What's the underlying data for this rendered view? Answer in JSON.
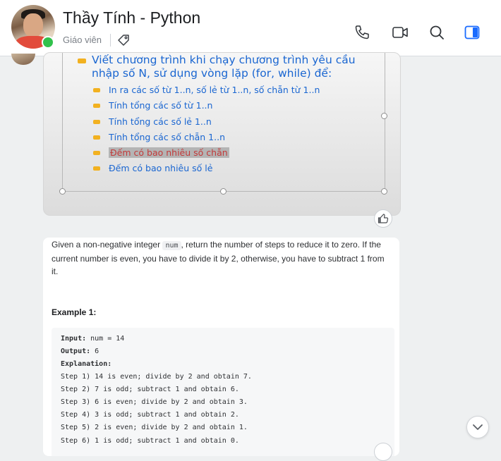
{
  "header": {
    "title": "Thầy Tính - Python",
    "subtitle": "Giáo viên",
    "icons": [
      "tag-icon",
      "phone-icon",
      "video-icon",
      "search-icon",
      "sidebar-toggle-icon"
    ],
    "accent": "#1a6bff"
  },
  "slide": {
    "main": "Viết chương trình khi chạy chương trình yêu cầu nhập số N, sử dụng vòng lặp (for, while) để:",
    "items": [
      "In ra các số từ 1..n, số lẻ từ 1..n, số chẵn từ 1..n",
      "Tính tổng các số từ 1..n",
      "Tính tổng các số lẻ 1..n",
      "Tính tổng các số chẵn 1..n",
      "Đếm có bao nhiêu số chẵn",
      "Đếm có bao nhiêu số lẻ"
    ],
    "highlighted_index": 4
  },
  "problem": {
    "desc_1": "Given a non-negative integer ",
    "code_num": "num",
    "desc_2": ", return the number of steps to reduce it to zero. If the current number is even, you have to divide it by 2, otherwise, you have to subtract 1 from it.",
    "example_title": "Example 1:",
    "input_label": "Input:",
    "input_value": " num = 14",
    "output_label": "Output:",
    "output_value": " 6",
    "explanation_label": "Explanation:",
    "steps": [
      "Step 1) 14 is even; divide by 2 and obtain 7.",
      "Step 2) 7 is odd; subtract 1 and obtain 6.",
      "Step 3) 6 is even; divide by 2 and obtain 3.",
      "Step 4) 3 is odd; subtract 1 and obtain 2.",
      "Step 5) 2 is even; divide by 2 and obtain 1.",
      "Step 6) 1 is odd; subtract 1 and obtain 0."
    ]
  }
}
